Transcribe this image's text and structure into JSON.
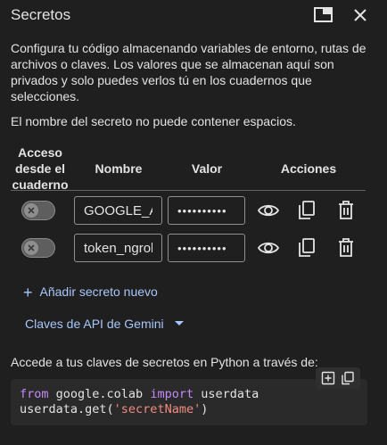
{
  "header": {
    "title": "Secretos"
  },
  "description": "Configura tu código almacenando variables de entorno, rutas de archivos o claves. Los valores que se almacenan aquí son privados y solo puedes verlos tú en los cuadernos que selecciones.",
  "note": "El nombre del secreto no puede contener espacios.",
  "table": {
    "headers": {
      "access_line1": "Acceso",
      "access_line2": "desde el",
      "access_line3": "cuaderno",
      "name": "Nombre",
      "value": "Valor",
      "actions": "Acciones"
    },
    "rows": [
      {
        "name": "GOOGLE_API_KEY",
        "value": "••••••••••",
        "access": false
      },
      {
        "name": "token_ngrok",
        "value": "••••••••••",
        "access": false
      }
    ]
  },
  "add_secret_label": "Añadir secreto nuevo",
  "gemini_label": "Claves de API de Gemini",
  "code_label": "Accede a tus claves de secretos en Python a través de:",
  "code": {
    "line1_kw1": "from",
    "line1_mod": " google.colab ",
    "line1_kw2": "import",
    "line1_name": " userdata",
    "line2_call": "userdata.get(",
    "line2_str": "'secretName'",
    "line2_end": ")"
  },
  "colors": {
    "accent": "#a8c7fa",
    "background": "#1f1f1f",
    "keyword": "#c58af9",
    "string": "#f28b82"
  }
}
